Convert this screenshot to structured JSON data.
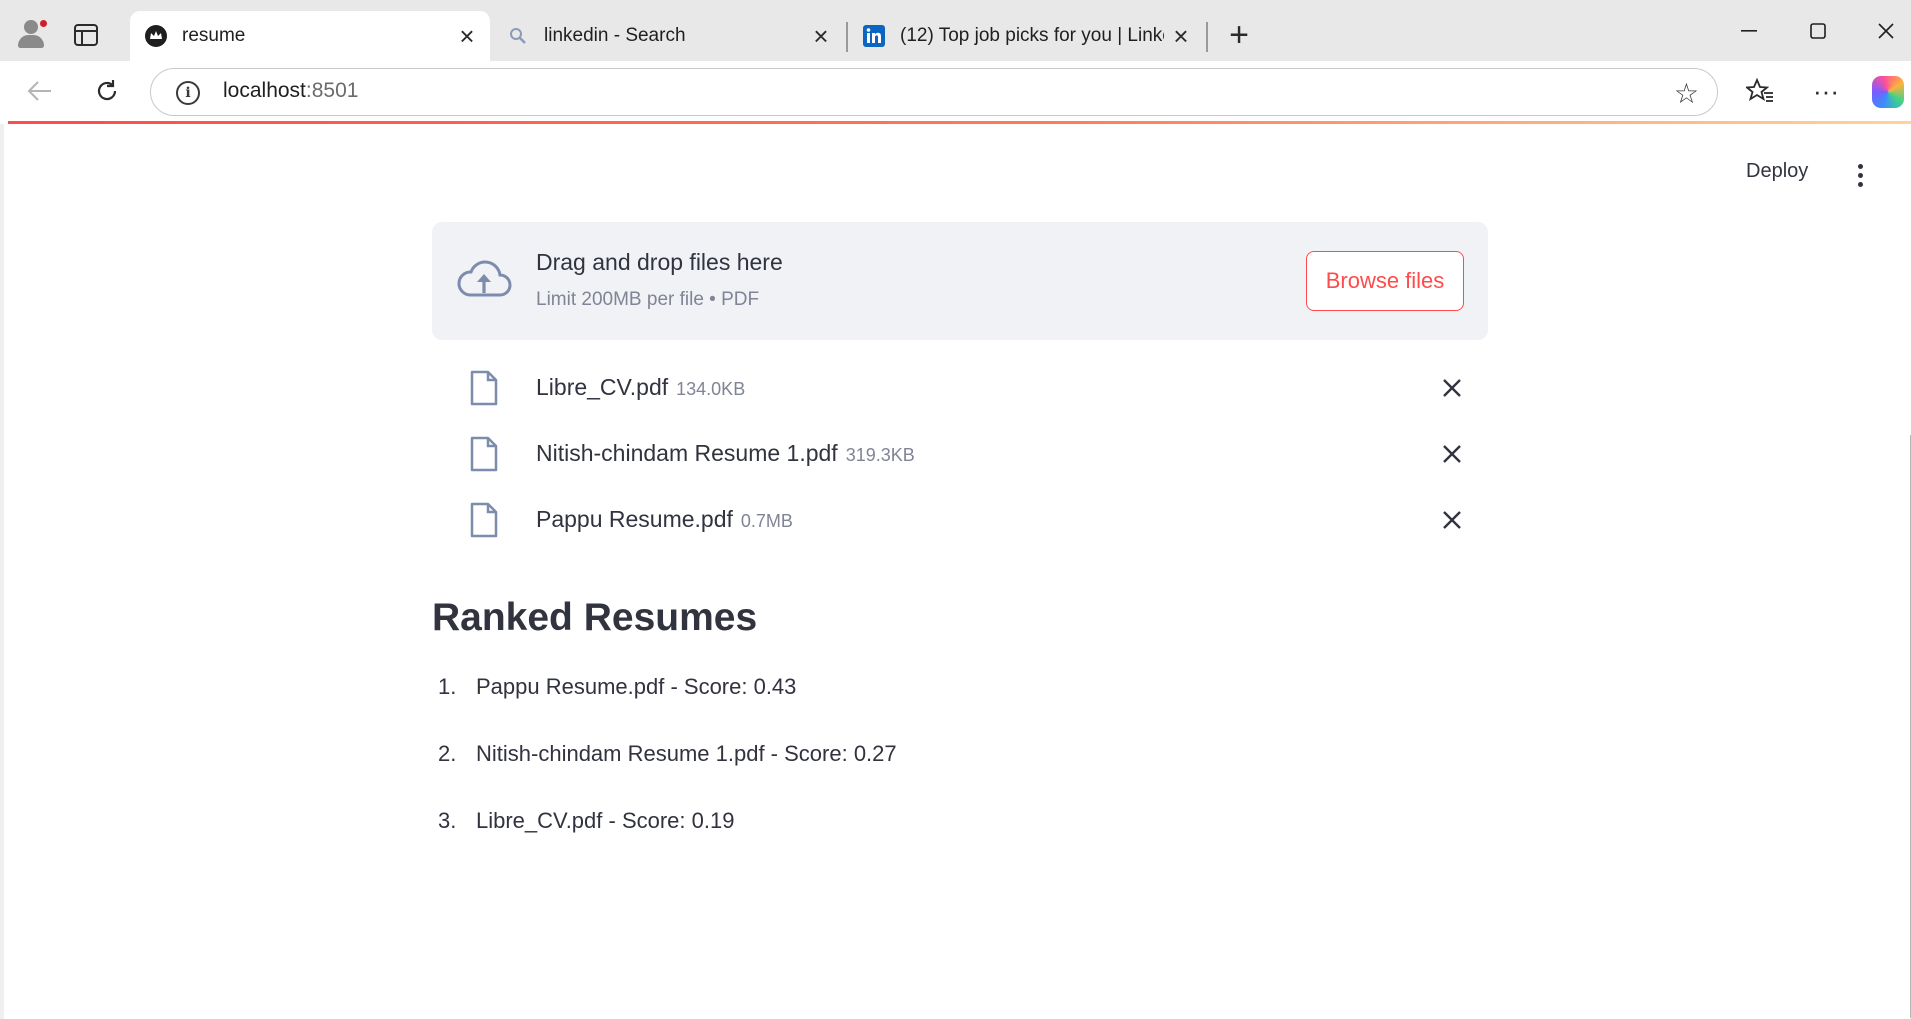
{
  "browser": {
    "tabs": [
      {
        "title": "resume",
        "favicon": "streamlit-crown-icon",
        "active": true
      },
      {
        "title": "linkedin - Search",
        "favicon": "search-icon",
        "active": false
      },
      {
        "title": "(12) Top job picks for you | Linked",
        "favicon": "linkedin-icon",
        "active": false
      }
    ],
    "address": {
      "host": "localhost",
      "port": ":8501"
    }
  },
  "app": {
    "header": {
      "deploy_label": "Deploy"
    },
    "uploader": {
      "title": "Drag and drop files here",
      "subtitle": "Limit 200MB per file • PDF",
      "browse_label": "Browse files"
    },
    "files": [
      {
        "name": "Libre_CV.pdf",
        "size": "134.0KB"
      },
      {
        "name": "Nitish-chindam Resume 1.pdf",
        "size": "319.3KB"
      },
      {
        "name": "Pappu Resume.pdf",
        "size": "0.7MB"
      }
    ],
    "ranked": {
      "title": "Ranked Resumes",
      "items": [
        {
          "num": "1.",
          "text": "Pappu Resume.pdf - Score: 0.43"
        },
        {
          "num": "2.",
          "text": "Nitish-chindam Resume 1.pdf - Score: 0.27"
        },
        {
          "num": "3.",
          "text": "Libre_CV.pdf - Score: 0.19"
        }
      ]
    }
  },
  "colors": {
    "accent": "#ff4b4b",
    "text": "#31333f",
    "muted": "#808495",
    "dropzone_bg": "#f0f2f6"
  }
}
